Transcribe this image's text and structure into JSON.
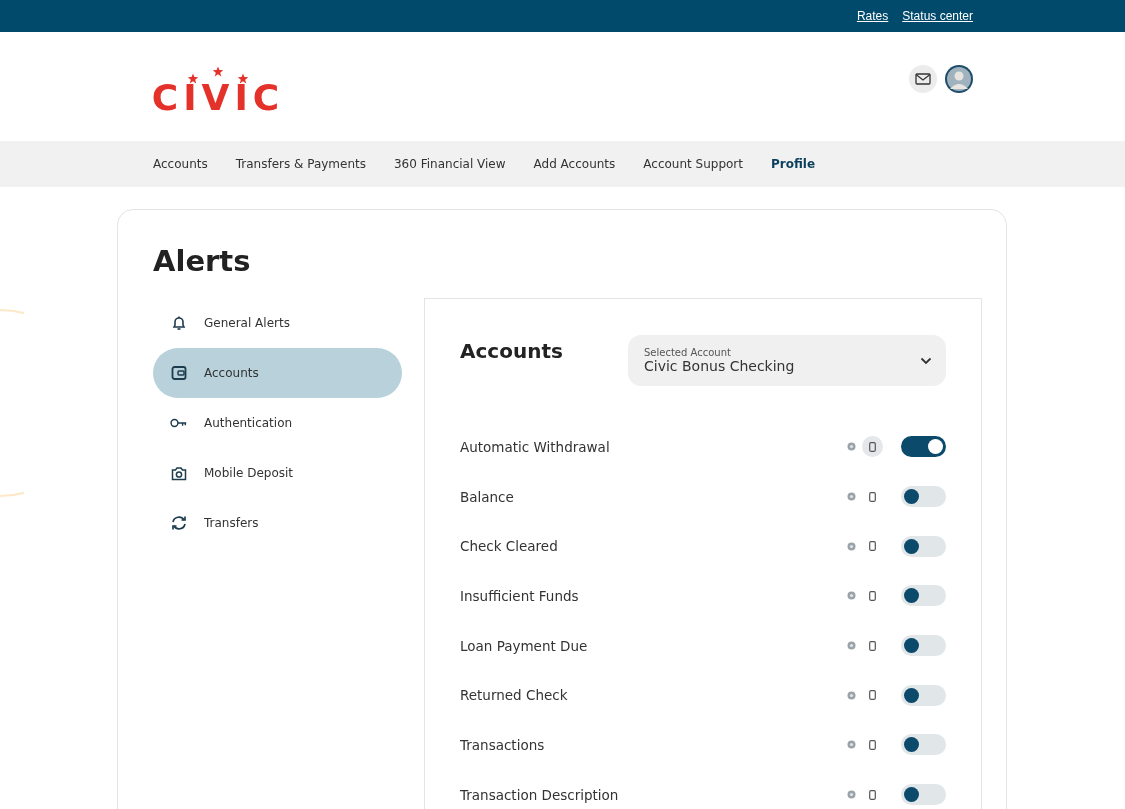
{
  "top_links": [
    "Rates",
    "Status center"
  ],
  "logo": {
    "text": "CIVIC"
  },
  "nav": [
    {
      "label": "Accounts",
      "selected": false
    },
    {
      "label": "Transfers & Payments",
      "selected": false
    },
    {
      "label": "360 Financial View",
      "selected": false
    },
    {
      "label": "Add Accounts",
      "selected": false
    },
    {
      "label": "Account Support",
      "selected": false
    },
    {
      "label": "Profile",
      "selected": true
    }
  ],
  "page_title": "Alerts",
  "sidebar": [
    {
      "label": "General Alerts",
      "kind": "bell",
      "selected": false
    },
    {
      "label": "Accounts",
      "kind": "wallet",
      "selected": true
    },
    {
      "label": "Authentication",
      "kind": "key",
      "selected": false
    },
    {
      "label": "Mobile Deposit",
      "kind": "camera",
      "selected": false
    },
    {
      "label": "Transfers",
      "kind": "sync",
      "selected": false
    }
  ],
  "panel": {
    "title": "Accounts",
    "account_select": {
      "label": "Selected Account",
      "value": "Civic Bonus Checking"
    }
  },
  "alerts": [
    {
      "label": "Automatic Withdrawal",
      "on": true,
      "phone_highlighted": true
    },
    {
      "label": "Balance",
      "on": false,
      "phone_highlighted": false
    },
    {
      "label": "Check Cleared",
      "on": false,
      "phone_highlighted": false
    },
    {
      "label": "Insufficient Funds",
      "on": false,
      "phone_highlighted": false
    },
    {
      "label": "Loan Payment Due",
      "on": false,
      "phone_highlighted": false
    },
    {
      "label": "Returned Check",
      "on": false,
      "phone_highlighted": false
    },
    {
      "label": "Transactions",
      "on": false,
      "phone_highlighted": false
    },
    {
      "label": "Transaction Description",
      "on": false,
      "phone_highlighted": false
    }
  ]
}
